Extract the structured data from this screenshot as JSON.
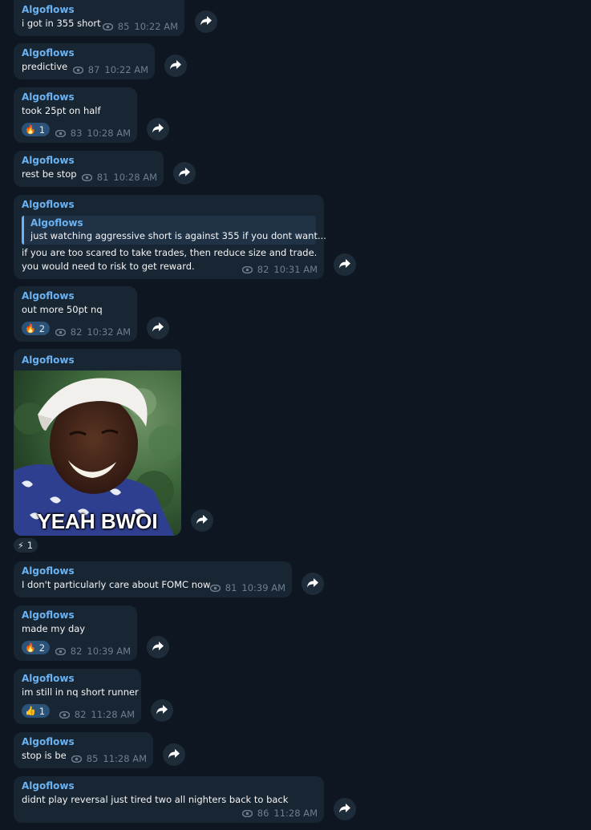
{
  "colors": {
    "background": "#0e1621",
    "bubble": "#182533",
    "sender": "#6ab3f3",
    "meta": "#6d7f8f",
    "reaction_bg": "#2b5278"
  },
  "messages": [
    {
      "sender": "Algoflows",
      "text": "i got in 355 short",
      "views": "85",
      "time": "10:22 AM"
    },
    {
      "sender": "Algoflows",
      "text": "predictive",
      "views": "87",
      "time": "10:22 AM"
    },
    {
      "sender": "Algoflows",
      "text": "took 25pt on half",
      "views": "83",
      "time": "10:28 AM",
      "reaction": {
        "icon": "fire-icon",
        "emoji": "🔥",
        "count": "1"
      }
    },
    {
      "sender": "Algoflows",
      "text": "rest be stop",
      "views": "81",
      "time": "10:28 AM"
    },
    {
      "sender": "Algoflows",
      "quote": {
        "name": "Algoflows",
        "text": "just watching  aggressive short is against 355 if you dont want..."
      },
      "line1": "if you are too scared to take trades, then reduce size and trade.",
      "line2": "you would need to risk to get reward.",
      "views": "82",
      "time": "10:31 AM"
    },
    {
      "sender": "Algoflows",
      "text": "out more 50pt nq",
      "views": "82",
      "time": "10:32 AM",
      "reaction": {
        "icon": "fire-icon",
        "emoji": "🔥",
        "count": "2"
      }
    },
    {
      "sender": "Algoflows",
      "media_caption": "YEAH BWOI",
      "reaction": {
        "icon": "lightning-icon",
        "emoji": "⚡",
        "count": "1"
      }
    },
    {
      "sender": "Algoflows",
      "text": "I don't particularly care about FOMC now",
      "views": "81",
      "time": "10:39 AM"
    },
    {
      "sender": "Algoflows",
      "text": "made my day",
      "views": "82",
      "time": "10:39 AM",
      "reaction": {
        "icon": "fire-icon",
        "emoji": "🔥",
        "count": "2"
      }
    },
    {
      "sender": "Algoflows",
      "text": "im still in nq short runner",
      "views": "82",
      "time": "11:28 AM",
      "reaction": {
        "icon": "thumbs-up-icon",
        "emoji": "👍",
        "count": "1"
      }
    },
    {
      "sender": "Algoflows",
      "text": "stop is be",
      "views": "85",
      "time": "11:28 AM"
    },
    {
      "sender": "Algoflows",
      "text": "didnt play reversal just tired two all nighters back to back",
      "views": "86",
      "time": "11:28 AM"
    }
  ]
}
